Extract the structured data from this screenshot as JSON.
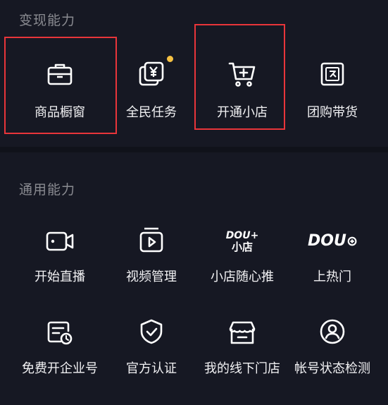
{
  "monetization": {
    "title": "变现能力",
    "items": [
      {
        "label": "商品橱窗",
        "icon": "showcase-icon"
      },
      {
        "label": "全民任务",
        "icon": "task-yuan-icon"
      },
      {
        "label": "开通小店",
        "icon": "cart-plus-icon"
      },
      {
        "label": "团购带货",
        "icon": "group-buy-icon"
      }
    ]
  },
  "general": {
    "title": "通用能力",
    "items": [
      {
        "label": "开始直播",
        "icon": "live-camera-icon"
      },
      {
        "label": "视频管理",
        "icon": "video-manage-icon"
      },
      {
        "label": "小店随心推",
        "icon": "dou-plus-shop-icon",
        "logo_text_top": "DOU+",
        "logo_text_bottom": "小店"
      },
      {
        "label": "上热门",
        "icon": "dou-plus-icon",
        "logo_text": "DOU"
      },
      {
        "label": "免费开企业号",
        "icon": "enterprise-account-icon"
      },
      {
        "label": "官方认证",
        "icon": "verified-shield-icon"
      },
      {
        "label": "我的线下门店",
        "icon": "offline-store-icon"
      },
      {
        "label": "帐号状态检测",
        "icon": "account-status-icon"
      }
    ]
  },
  "colors": {
    "background": "#161823",
    "highlight": "#e8353a",
    "badge": "#f6c143"
  }
}
